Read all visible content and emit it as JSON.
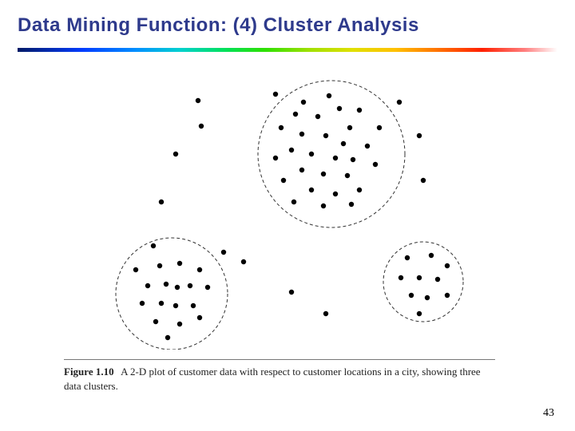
{
  "slide": {
    "title": "Data Mining Function: (4) Cluster Analysis",
    "page_number": "43"
  },
  "caption": {
    "figure_label": "Figure 1.10",
    "text": "A 2-D plot of customer data with respect to customer locations in a city, showing three data clusters."
  },
  "chart_data": {
    "type": "scatter",
    "title": "",
    "xlabel": "",
    "ylabel": "",
    "xlim": [
      0,
      480
    ],
    "ylim": [
      0,
      340
    ],
    "cluster_rings": [
      {
        "name": "top-cluster",
        "cx": 285,
        "cy": 95,
        "r": 92
      },
      {
        "name": "left-cluster",
        "cx": 85,
        "cy": 270,
        "r": 70
      },
      {
        "name": "right-cluster",
        "cx": 400,
        "cy": 255,
        "r": 50
      }
    ],
    "points": [
      {
        "x": 118,
        "y": 28
      },
      {
        "x": 370,
        "y": 30
      },
      {
        "x": 215,
        "y": 20
      },
      {
        "x": 250,
        "y": 30
      },
      {
        "x": 282,
        "y": 22
      },
      {
        "x": 240,
        "y": 45
      },
      {
        "x": 268,
        "y": 48
      },
      {
        "x": 295,
        "y": 38
      },
      {
        "x": 320,
        "y": 40
      },
      {
        "x": 345,
        "y": 62
      },
      {
        "x": 308,
        "y": 62
      },
      {
        "x": 222,
        "y": 62
      },
      {
        "x": 248,
        "y": 70
      },
      {
        "x": 278,
        "y": 72
      },
      {
        "x": 300,
        "y": 82
      },
      {
        "x": 330,
        "y": 85
      },
      {
        "x": 260,
        "y": 95
      },
      {
        "x": 235,
        "y": 90
      },
      {
        "x": 215,
        "y": 100
      },
      {
        "x": 290,
        "y": 100
      },
      {
        "x": 312,
        "y": 102
      },
      {
        "x": 340,
        "y": 108
      },
      {
        "x": 248,
        "y": 115
      },
      {
        "x": 275,
        "y": 120
      },
      {
        "x": 305,
        "y": 122
      },
      {
        "x": 225,
        "y": 128
      },
      {
        "x": 260,
        "y": 140
      },
      {
        "x": 290,
        "y": 145
      },
      {
        "x": 320,
        "y": 140
      },
      {
        "x": 238,
        "y": 155
      },
      {
        "x": 275,
        "y": 160
      },
      {
        "x": 310,
        "y": 158
      },
      {
        "x": 122,
        "y": 60
      },
      {
        "x": 395,
        "y": 72
      },
      {
        "x": 90,
        "y": 95
      },
      {
        "x": 400,
        "y": 128
      },
      {
        "x": 72,
        "y": 155
      },
      {
        "x": 62,
        "y": 210
      },
      {
        "x": 150,
        "y": 218
      },
      {
        "x": 40,
        "y": 240
      },
      {
        "x": 70,
        "y": 235
      },
      {
        "x": 95,
        "y": 232
      },
      {
        "x": 120,
        "y": 240
      },
      {
        "x": 55,
        "y": 260
      },
      {
        "x": 78,
        "y": 258
      },
      {
        "x": 92,
        "y": 262
      },
      {
        "x": 108,
        "y": 260
      },
      {
        "x": 130,
        "y": 262
      },
      {
        "x": 48,
        "y": 282
      },
      {
        "x": 72,
        "y": 282
      },
      {
        "x": 90,
        "y": 285
      },
      {
        "x": 112,
        "y": 285
      },
      {
        "x": 65,
        "y": 305
      },
      {
        "x": 95,
        "y": 308
      },
      {
        "x": 120,
        "y": 300
      },
      {
        "x": 80,
        "y": 325
      },
      {
        "x": 175,
        "y": 230
      },
      {
        "x": 235,
        "y": 268
      },
      {
        "x": 278,
        "y": 295
      },
      {
        "x": 380,
        "y": 225
      },
      {
        "x": 410,
        "y": 222
      },
      {
        "x": 430,
        "y": 235
      },
      {
        "x": 372,
        "y": 250
      },
      {
        "x": 395,
        "y": 250
      },
      {
        "x": 418,
        "y": 252
      },
      {
        "x": 385,
        "y": 272
      },
      {
        "x": 405,
        "y": 275
      },
      {
        "x": 430,
        "y": 272
      },
      {
        "x": 395,
        "y": 295
      }
    ]
  }
}
